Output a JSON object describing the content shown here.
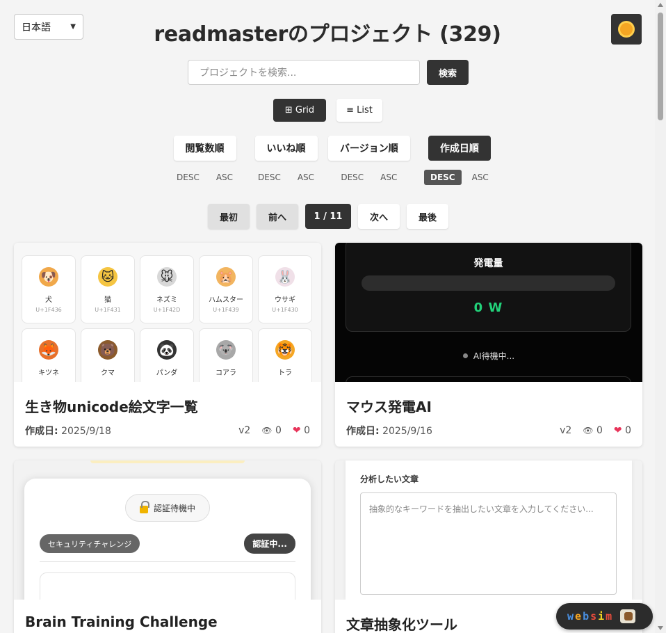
{
  "header": {
    "language": "日本語",
    "title": "readmasterのプロジェクト (329)"
  },
  "search": {
    "placeholder": "プロジェクトを検索...",
    "button": "検索"
  },
  "view_toggle": {
    "grid": "⊞ Grid",
    "list": "≡ List",
    "active": "grid"
  },
  "sort": [
    {
      "label": "閲覧数順",
      "desc": "DESC",
      "asc": "ASC",
      "active": false
    },
    {
      "label": "いいね順",
      "desc": "DESC",
      "asc": "ASC",
      "active": false
    },
    {
      "label": "バージョン順",
      "desc": "DESC",
      "asc": "ASC",
      "active": false
    },
    {
      "label": "作成日順",
      "desc": "DESC",
      "asc": "ASC",
      "active": true,
      "direction": "DESC"
    }
  ],
  "pagination": {
    "first": "最初",
    "prev": "前へ",
    "current": "1 / 11",
    "next": "次へ",
    "last": "最後"
  },
  "cards": [
    {
      "title": "生き物unicode絵文字一覧",
      "date_label": "作成日:",
      "date": "2025/9/18",
      "version": "v2",
      "views": "0",
      "likes": "0",
      "emoji": [
        {
          "name": "犬",
          "code": "U+1F436",
          "icon": "dog-face-icon",
          "color": "#f0a84a",
          "glyph": "🐶"
        },
        {
          "name": "猫",
          "code": "U+1F431",
          "icon": "cat-face-icon",
          "color": "#f5c542",
          "glyph": "🐱"
        },
        {
          "name": "ネズミ",
          "code": "U+1F42D",
          "icon": "mouse-face-icon",
          "color": "#d8d8d8",
          "glyph": "🐭"
        },
        {
          "name": "ハムスター",
          "code": "U+1F439",
          "icon": "hamster-face-icon",
          "color": "#f2b560",
          "glyph": "🐹"
        },
        {
          "name": "ウサギ",
          "code": "U+1F430",
          "icon": "rabbit-face-icon",
          "color": "#f0e0e8",
          "glyph": "🐰"
        },
        {
          "name": "キツネ",
          "code": "",
          "icon": "fox-face-icon",
          "color": "#e8702a",
          "glyph": "🦊"
        },
        {
          "name": "クマ",
          "code": "",
          "icon": "bear-face-icon",
          "color": "#8b5a2b",
          "glyph": "🐻"
        },
        {
          "name": "パンダ",
          "code": "",
          "icon": "panda-face-icon",
          "color": "#333333",
          "glyph": "🐼"
        },
        {
          "name": "コアラ",
          "code": "",
          "icon": "koala-face-icon",
          "color": "#a8a8a8",
          "glyph": "🐨"
        },
        {
          "name": "トラ",
          "code": "",
          "icon": "tiger-face-icon",
          "color": "#f5a623",
          "glyph": "🐯"
        }
      ]
    },
    {
      "title": "マウス発電AI",
      "date_label": "作成日:",
      "date": "2025/9/16",
      "version": "v2",
      "views": "0",
      "likes": "0",
      "preview": {
        "label": "発電量",
        "value": "0 W",
        "status": "AI待機中..."
      }
    },
    {
      "title": "Brain Training Challenge",
      "preview": {
        "pill": "認証待機中",
        "tag": "セキュリティチャレンジ",
        "status": "認証中..."
      }
    },
    {
      "title": "文章抽象化ツール",
      "preview": {
        "label": "分析したい文章",
        "placeholder": "抽象的なキーワードを抽出したい文章を入力してください..."
      }
    }
  ],
  "badge": {
    "letters": [
      {
        "ch": "w",
        "color": "#4a90e2"
      },
      {
        "ch": "e",
        "color": "#f5a623"
      },
      {
        "ch": "b",
        "color": "#4a90e2"
      },
      {
        "ch": "s",
        "color": "#e74c3c"
      },
      {
        "ch": "i",
        "color": "#f5d623"
      },
      {
        "ch": "m",
        "color": "#e74c3c"
      }
    ]
  },
  "colors": {
    "dark": "#333333",
    "power_value": "#22d27a",
    "heart": "#e8345a"
  }
}
